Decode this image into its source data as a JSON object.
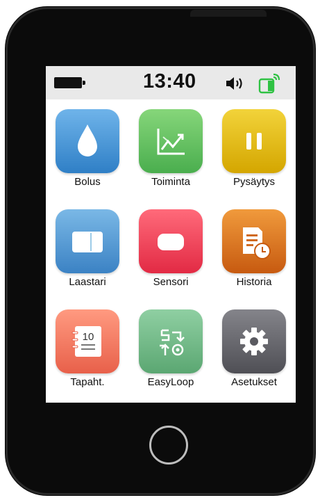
{
  "status_bar": {
    "time": "13:40"
  },
  "apps": [
    {
      "label": "Bolus",
      "icon": "drop-icon"
    },
    {
      "label": "Toiminta",
      "icon": "chart-icon"
    },
    {
      "label": "Pysäytys",
      "icon": "pause-icon"
    },
    {
      "label": "Laastari",
      "icon": "patch-icon"
    },
    {
      "label": "Sensori",
      "icon": "sensor-icon"
    },
    {
      "label": "Historia",
      "icon": "history-icon"
    },
    {
      "label": "Tapaht.",
      "icon": "calendar-icon"
    },
    {
      "label": "EasyLoop",
      "icon": "loop-icon"
    },
    {
      "label": "Asetukset",
      "icon": "gear-icon"
    }
  ],
  "calendar_day": "10",
  "colors": {
    "bolus": "#3b8fd6",
    "toiminta": "#5fbf5c",
    "pysaytys": "#e0b800",
    "laastari": "#4a95d0",
    "sensori": "#ee3b52",
    "historia": "#e0701a",
    "tapahtumat": "#f0745c",
    "easyloop": "#6dba86",
    "asetukset": "#606066",
    "signal": "#2fc243"
  }
}
